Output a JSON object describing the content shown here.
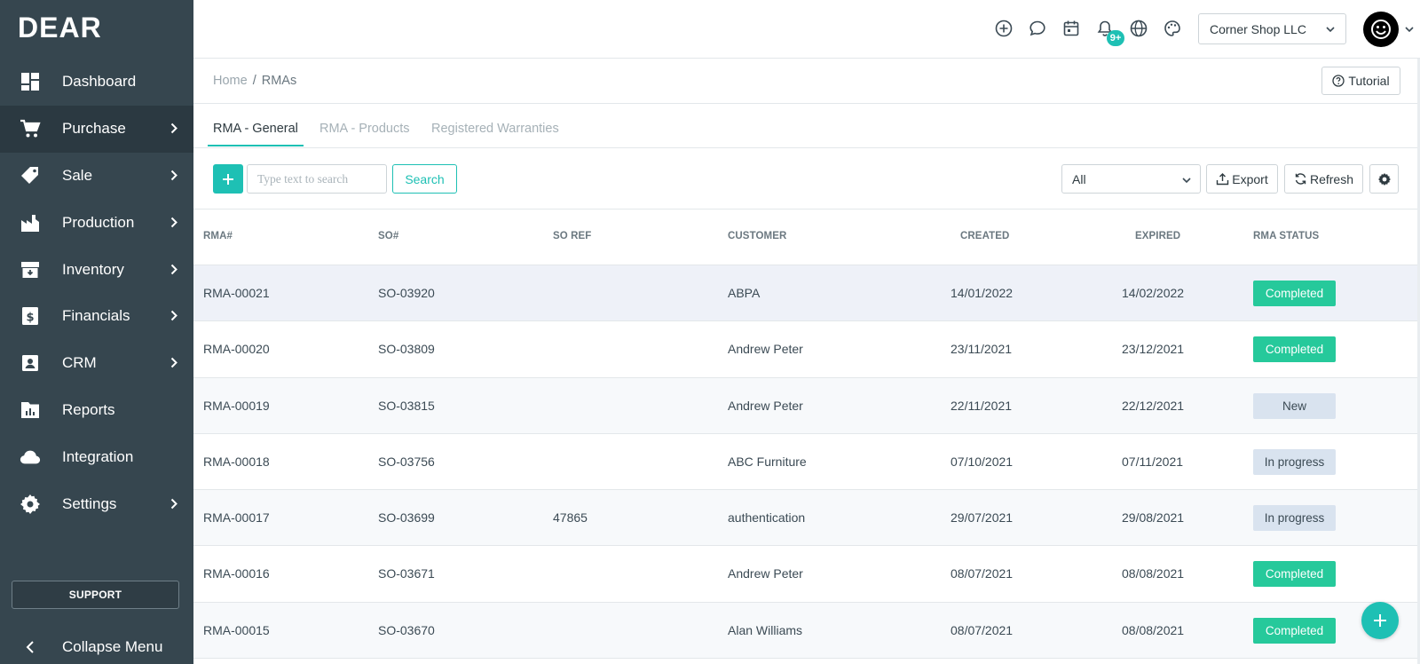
{
  "brand": {
    "logo_text": "DEAR"
  },
  "sidebar": {
    "items": [
      {
        "label": "Dashboard",
        "icon": "dashboard-icon",
        "has_submenu": false,
        "active": false
      },
      {
        "label": "Purchase",
        "icon": "cart-icon",
        "has_submenu": true,
        "active": true
      },
      {
        "label": "Sale",
        "icon": "tag-icon",
        "has_submenu": true,
        "active": false
      },
      {
        "label": "Production",
        "icon": "factory-icon",
        "has_submenu": true,
        "active": false
      },
      {
        "label": "Inventory",
        "icon": "inventory-icon",
        "has_submenu": true,
        "active": false
      },
      {
        "label": "Financials",
        "icon": "dollar-icon",
        "has_submenu": true,
        "active": false
      },
      {
        "label": "CRM",
        "icon": "contact-icon",
        "has_submenu": true,
        "active": false
      },
      {
        "label": "Reports",
        "icon": "reports-icon",
        "has_submenu": false,
        "active": false
      },
      {
        "label": "Integration",
        "icon": "cloud-icon",
        "has_submenu": false,
        "active": false
      },
      {
        "label": "Settings",
        "icon": "gear-icon",
        "has_submenu": true,
        "active": false
      }
    ],
    "support_label": "SUPPORT",
    "collapse_label": "Collapse Menu"
  },
  "topbar": {
    "icons": [
      "add-circle-icon",
      "chat-icon",
      "calendar-icon",
      "bell-icon",
      "globe-icon",
      "palette-icon"
    ],
    "notification_badge": "9+",
    "company": "Corner Shop LLC"
  },
  "breadcrumb": {
    "home": "Home",
    "separator": "/",
    "current": "RMAs"
  },
  "tutorial_label": "Tutorial",
  "tabs": [
    {
      "label": "RMA - General",
      "active": true
    },
    {
      "label": "RMA - Products",
      "active": false
    },
    {
      "label": "Registered Warranties",
      "active": false
    }
  ],
  "toolbar": {
    "search_placeholder": "Type text to search",
    "search_label": "Search",
    "filter_value": "All",
    "export_label": "Export",
    "refresh_label": "Refresh"
  },
  "table": {
    "columns": [
      "RMA#",
      "SO#",
      "SO REF",
      "CUSTOMER",
      "CREATED",
      "EXPIRED",
      "RMA STATUS"
    ],
    "rows": [
      {
        "rma": "RMA-00021",
        "so": "SO-03920",
        "so_ref": "",
        "customer": "ABPA",
        "created": "14/01/2022",
        "expired": "14/02/2022",
        "status": "Completed",
        "status_kind": "completed"
      },
      {
        "rma": "RMA-00020",
        "so": "SO-03809",
        "so_ref": "",
        "customer": "Andrew Peter",
        "created": "23/11/2021",
        "expired": "23/12/2021",
        "status": "Completed",
        "status_kind": "completed"
      },
      {
        "rma": "RMA-00019",
        "so": "SO-03815",
        "so_ref": "",
        "customer": "Andrew Peter",
        "created": "22/11/2021",
        "expired": "22/12/2021",
        "status": "New",
        "status_kind": "new"
      },
      {
        "rma": "RMA-00018",
        "so": "SO-03756",
        "so_ref": "",
        "customer": "ABC Furniture",
        "created": "07/10/2021",
        "expired": "07/11/2021",
        "status": "In progress",
        "status_kind": "progress"
      },
      {
        "rma": "RMA-00017",
        "so": "SO-03699",
        "so_ref": "47865",
        "customer": "authentication",
        "created": "29/07/2021",
        "expired": "29/08/2021",
        "status": "In progress",
        "status_kind": "progress"
      },
      {
        "rma": "RMA-00016",
        "so": "SO-03671",
        "so_ref": "",
        "customer": "Andrew Peter",
        "created": "08/07/2021",
        "expired": "08/08/2021",
        "status": "Completed",
        "status_kind": "completed"
      },
      {
        "rma": "RMA-00015",
        "so": "SO-03670",
        "so_ref": "",
        "customer": "Alan Williams",
        "created": "08/07/2021",
        "expired": "08/08/2021",
        "status": "Completed",
        "status_kind": "completed"
      }
    ]
  },
  "colors": {
    "sidebar_bg": "#36464f",
    "accent": "#1ec0b4",
    "completed": "#26c99b",
    "pending": "#d9e3ef"
  }
}
